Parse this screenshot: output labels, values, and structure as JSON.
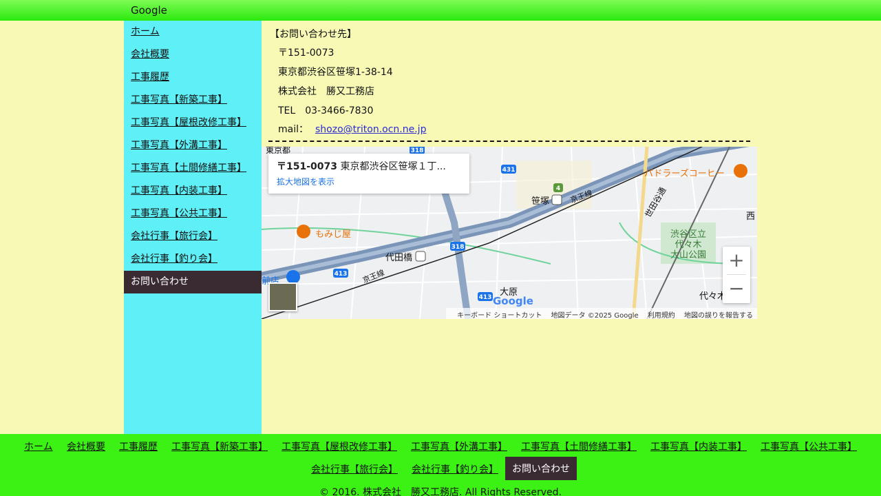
{
  "topbar": {
    "brand": "Google"
  },
  "sidebar": {
    "items": [
      {
        "label": "ホーム"
      },
      {
        "label": "会社概要"
      },
      {
        "label": "工事履歴"
      },
      {
        "label": "工事写真【新築工事】"
      },
      {
        "label": "工事写真【屋根改修工事】"
      },
      {
        "label": "工事写真【外溝工事】"
      },
      {
        "label": "工事写真【土間修繕工事】"
      },
      {
        "label": "工事写真【内装工事】"
      },
      {
        "label": "工事写真【公共工事】"
      },
      {
        "label": "会社行事【旅行会】"
      },
      {
        "label": "会社行事【釣り会】"
      },
      {
        "label": "お問い合わせ",
        "active": true
      }
    ]
  },
  "contact": {
    "heading": "【お問い合わせ先】",
    "postal": "〒151-0073",
    "address": "東京都渋谷区笹塚1-38-14",
    "company": "株式会社　勝又工務店",
    "tel": "TEL　03-3466-7830",
    "mail_label": "mail：",
    "mail": "shozo@triton.ocn.ne.jp"
  },
  "map": {
    "card_postal": "〒151-0073",
    "card_address": " 東京都渋谷区笹塚１丁...",
    "larger_map": "拡大地図を表示",
    "zoom_in": "+",
    "zoom_out": "−",
    "google_logo": "Google",
    "footer": {
      "shortcuts": "キーボード ショートカット",
      "mapdata": "地図データ ©2025 Google",
      "terms": "利用規約",
      "report": "地図の誤りを報告する"
    },
    "labels": {
      "momiji": "もみじ屋",
      "paddlers": "パドラーズコーヒー",
      "sasazuka": "笹塚",
      "keio1": "京王線",
      "keio2": "京王線",
      "daitabashi": "代田橋",
      "ohara": "大原",
      "park": "渋谷区立\n代々木\n大山公園",
      "setagaya": "世田谷通",
      "nishi": "西",
      "yoyogi": "代々木",
      "tokyoto": "東京都",
      "maeten": "前店",
      "r318a": "318",
      "r318b": "318",
      "r431": "431",
      "r413a": "413",
      "r413b": "413",
      "r4": "4"
    },
    "colors": {
      "highway": "#7a95b8",
      "railway": "#222222",
      "poi_orange": "#e8710a",
      "route_shield": "#1a73e8"
    }
  },
  "footer": {
    "nav": [
      {
        "label": "ホーム"
      },
      {
        "label": "会社概要"
      },
      {
        "label": "工事履歴"
      },
      {
        "label": "工事写真【新築工事】"
      },
      {
        "label": "工事写真【屋根改修工事】"
      },
      {
        "label": "工事写真【外溝工事】"
      },
      {
        "label": "工事写真【土間修繕工事】"
      },
      {
        "label": "工事写真【内装工事】"
      },
      {
        "label": "工事写真【公共工事】"
      },
      {
        "label": "会社行事【旅行会】"
      },
      {
        "label": "会社行事【釣り会】"
      },
      {
        "label": "お問い合わせ",
        "active": true
      }
    ],
    "copyright": "© 2016. 株式会社　勝又工務店. All Rights Reserved."
  }
}
